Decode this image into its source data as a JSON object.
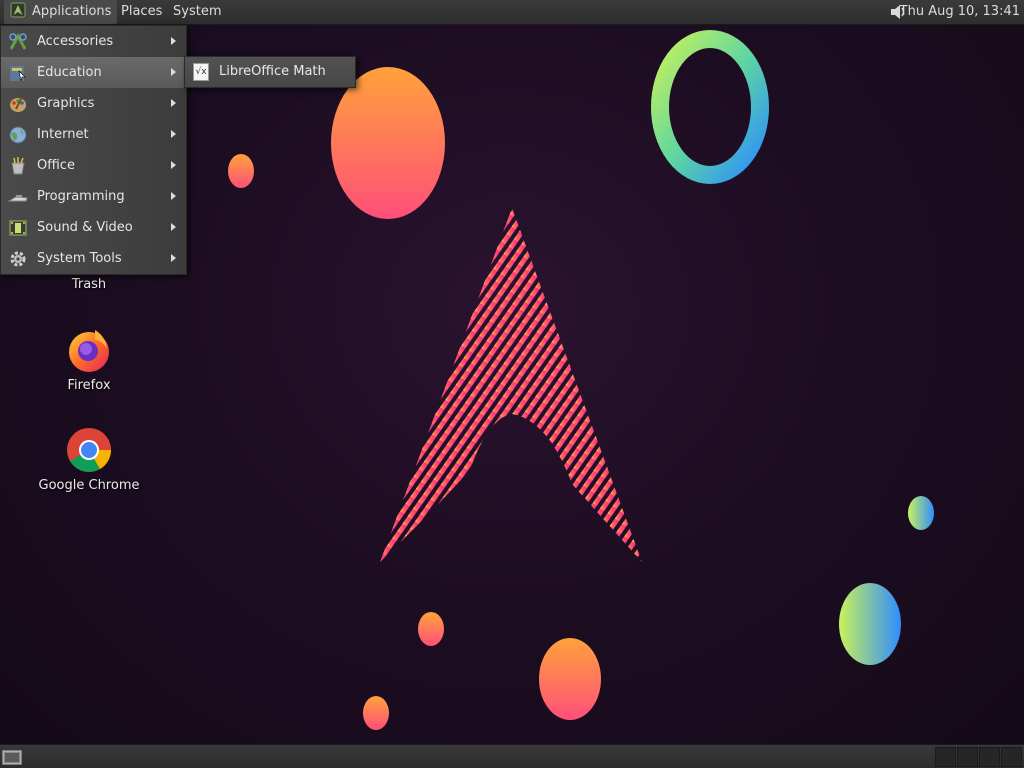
{
  "top_panel": {
    "applications_label": "Applications",
    "places_label": "Places",
    "system_label": "System",
    "clock": "Thu Aug 10, 13:41"
  },
  "apps_menu": {
    "items": [
      {
        "label": "Accessories",
        "icon": "accessories-icon"
      },
      {
        "label": "Education",
        "icon": "education-icon"
      },
      {
        "label": "Graphics",
        "icon": "graphics-icon"
      },
      {
        "label": "Internet",
        "icon": "internet-icon"
      },
      {
        "label": "Office",
        "icon": "office-icon"
      },
      {
        "label": "Programming",
        "icon": "programming-icon"
      },
      {
        "label": "Sound & Video",
        "icon": "sound-video-icon"
      },
      {
        "label": "System Tools",
        "icon": "system-tools-icon"
      }
    ],
    "active_item": "Education"
  },
  "education_submenu": {
    "items": [
      {
        "label": "LibreOffice Math",
        "icon": "libreoffice-math-icon"
      }
    ]
  },
  "desktop_icons": {
    "trash": "Trash",
    "firefox": "Firefox",
    "chrome": "Google Chrome"
  },
  "colors": {
    "panel": "#333333",
    "menu": "#444444",
    "menu_active": "#606060",
    "wallpaper": "#1d0d22"
  }
}
